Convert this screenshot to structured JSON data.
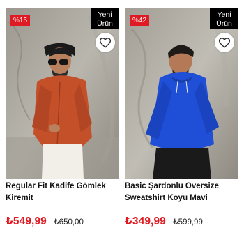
{
  "products": [
    {
      "discount_badge": "%15",
      "new_badge_line1": "Yeni",
      "new_badge_line2": "Ürün",
      "title": "Regular Fit Kadife Gömlek Kiremit",
      "price": "₺549,99",
      "old_price": "₺650,00",
      "garment_color": "#c4502a"
    },
    {
      "discount_badge": "%42",
      "new_badge_line1": "Yeni",
      "new_badge_line2": "Ürün",
      "title": "Basic Şardonlu Oversize Sweatshirt Koyu Mavi",
      "price": "₺349,99",
      "old_price": "₺599,99",
      "garment_color": "#1f4fd6"
    }
  ],
  "colors": {
    "sale_red": "#e01a22",
    "badge_black": "#000000",
    "text_dark": "#111111"
  },
  "icons": {
    "favorite": "heart-outline-icon"
  }
}
